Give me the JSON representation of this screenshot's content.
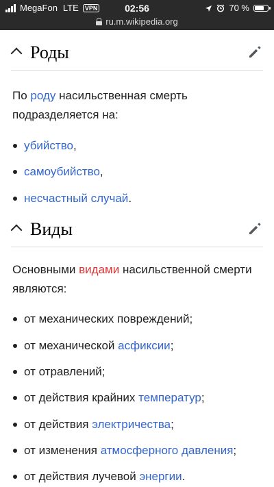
{
  "status_bar": {
    "carrier": "MegaFon",
    "network": "LTE",
    "vpn": "VPN",
    "time": "02:56",
    "battery": "70 %",
    "battery_level": 0.7,
    "url": "ru.m.wikipedia.org"
  },
  "sections": [
    {
      "title": "Роды",
      "intro": {
        "before": "По ",
        "link": "роду",
        "after": " насильственная смерть подразделяется на:"
      },
      "items": [
        {
          "pre": "",
          "link": "убийство",
          "post": ",",
          "link_color": "blue"
        },
        {
          "pre": "",
          "link": "самоубийство",
          "post": ",",
          "link_color": "blue"
        },
        {
          "pre": "",
          "link": "несчастный случай",
          "post": ".",
          "link_color": "blue"
        }
      ]
    },
    {
      "title": "Виды",
      "intro": {
        "before": "Основными ",
        "link": "видами",
        "after": " насильственной смерти являются:"
      },
      "items": [
        {
          "pre": "от механических повреждений;",
          "link": "",
          "post": ""
        },
        {
          "pre": "от механической ",
          "link": "асфиксии",
          "post": ";"
        },
        {
          "pre": "от отравлений;",
          "link": "",
          "post": ""
        },
        {
          "pre": "от действия крайних ",
          "link": "температур",
          "post": ";"
        },
        {
          "pre": "от действия ",
          "link": "электричества",
          "post": ";"
        },
        {
          "pre": "от изменения ",
          "link": "атмосферного давления",
          "post": ";"
        },
        {
          "pre": "от действия лучевой ",
          "link": "энергии",
          "post": "."
        }
      ]
    }
  ],
  "colors": {
    "link": "#3366cc",
    "redlink": "#dd3333",
    "text": "#202122",
    "status_bar_bg": "#2a2a2a"
  }
}
